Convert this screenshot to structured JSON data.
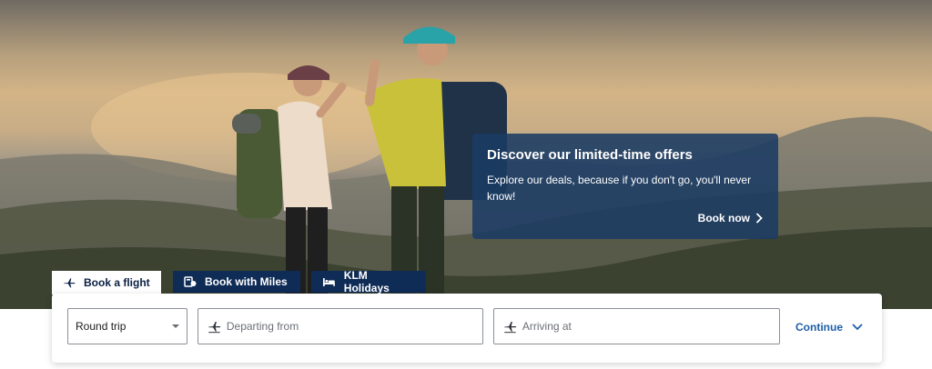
{
  "promo": {
    "title": "Discover our limited-time offers",
    "text": "Explore our deals, because if you don't go, you'll never know!",
    "link_label": "Book now"
  },
  "tabs": [
    {
      "label": "Book a flight",
      "icon": "plane-icon",
      "active": true
    },
    {
      "label": "Book with Miles",
      "icon": "miles-card-icon",
      "active": false
    },
    {
      "label": "KLM Holidays",
      "icon": "bed-icon",
      "active": false
    }
  ],
  "search": {
    "trip_type": "Round trip",
    "departure_placeholder": "Departing from",
    "arrival_placeholder": "Arriving at",
    "continue_label": "Continue"
  },
  "colors": {
    "brand_dark": "#0f2c57",
    "promo_bg": "#1b3b63",
    "link_blue": "#1c5ea8"
  }
}
